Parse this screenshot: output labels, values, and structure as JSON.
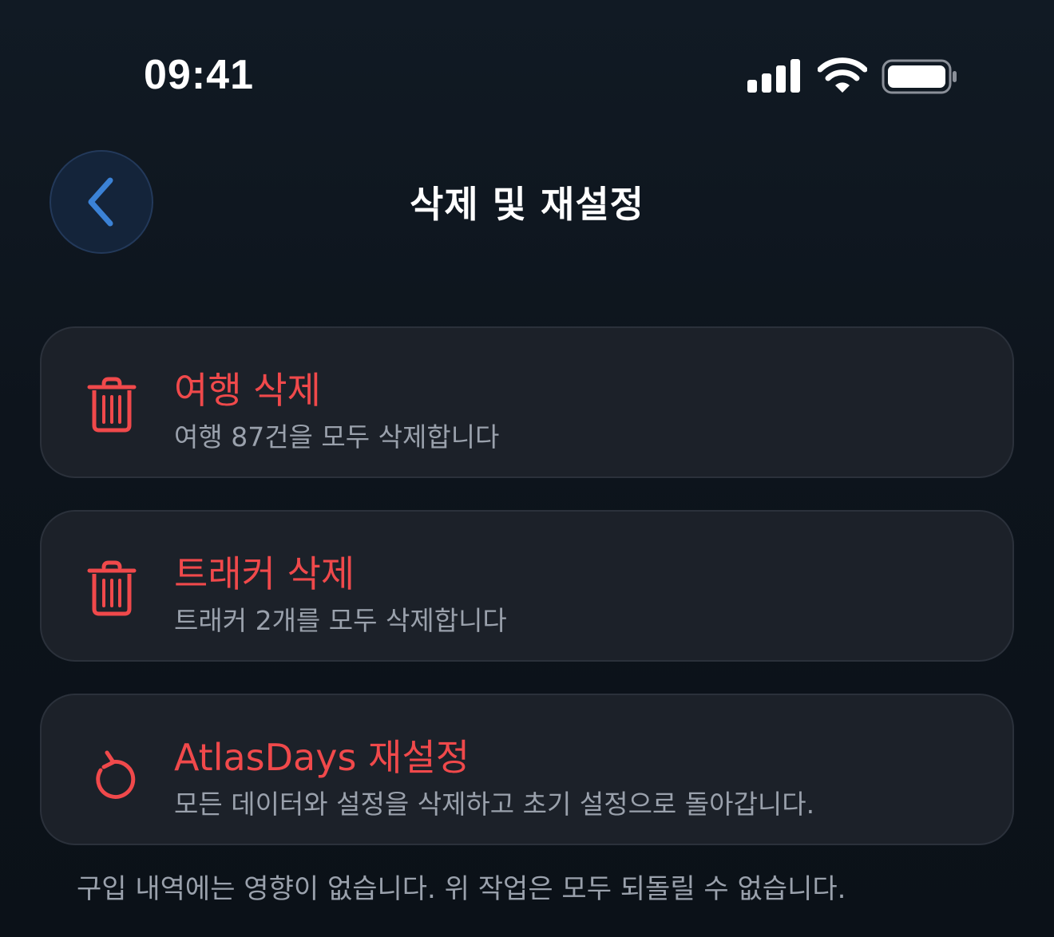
{
  "status_bar": {
    "time": "09:41",
    "icons": [
      "cellular-signal-icon",
      "wifi-icon",
      "battery-icon"
    ]
  },
  "nav": {
    "back_icon": "chevron-left-icon",
    "title": "삭제 및 재설정"
  },
  "options": [
    {
      "icon": "trash-icon",
      "title": "여행 삭제",
      "subtitle": "여행 87건을 모두 삭제합니다"
    },
    {
      "icon": "trash-icon",
      "title": "트래커 삭제",
      "subtitle": "트래커 2개를 모두 삭제합니다"
    },
    {
      "icon": "reset-arrow-icon",
      "title": "AtlasDays 재설정",
      "subtitle": "모든 데이터와 설정을 삭제하고 초기 설정으로 돌아갑니다."
    }
  ],
  "footer_note": "구입 내역에는 영향이 없습니다. 위 작업은 모두 되돌릴 수 없습니다.",
  "colors": {
    "background": "#0f1720",
    "card": "#1c2129",
    "destructive": "#f0494b",
    "secondary_text": "#9aa1ac",
    "accent": "#3b82d6"
  }
}
